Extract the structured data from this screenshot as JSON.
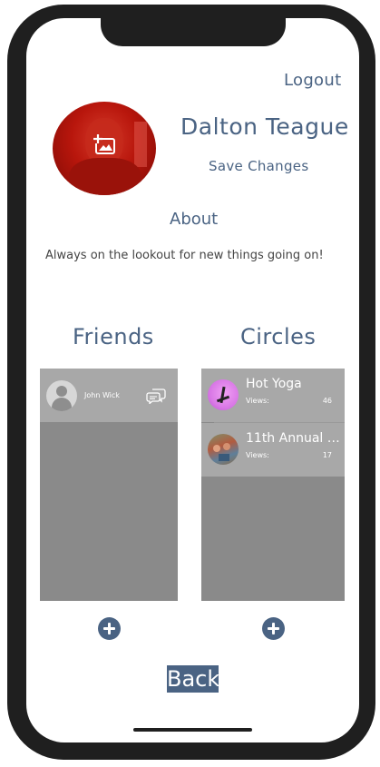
{
  "header": {
    "logout_label": "Logout"
  },
  "profile": {
    "name": "Dalton Teague",
    "save_label": "Save Changes",
    "about_title": "About",
    "about_text": "Always on the lookout for new things going on!"
  },
  "friends": {
    "title": "Friends",
    "items": [
      {
        "name": "John Wick",
        "icon": "chat-icon"
      }
    ]
  },
  "circles": {
    "title": "Circles",
    "items": [
      {
        "name": "Hot Yoga",
        "views_label": "Views:",
        "views": "46"
      },
      {
        "name": "11th Annual F...",
        "views_label": "Views:",
        "views": "17"
      }
    ]
  },
  "footer": {
    "back_label": "Back"
  },
  "colors": {
    "accent": "#4a6383",
    "panel": "#8a8a8a",
    "row": "#a8a8a8"
  },
  "icons": [
    "upload-image-icon",
    "default-avatar-icon",
    "chat-icon",
    "add-icon"
  ]
}
